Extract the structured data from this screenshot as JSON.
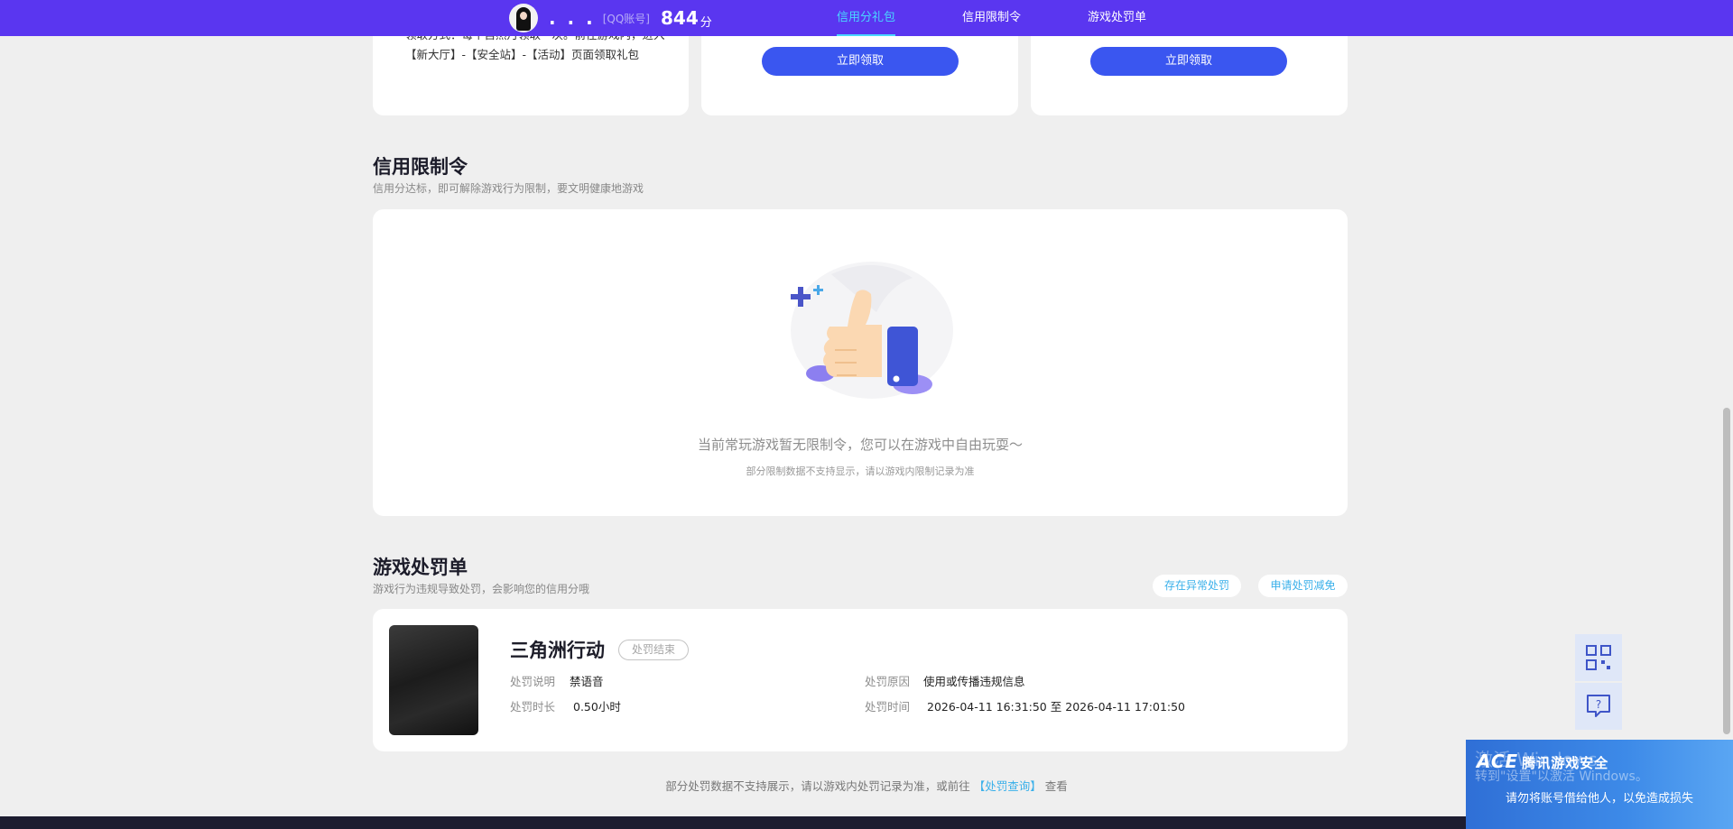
{
  "header": {
    "nickname": ". . .",
    "account_label": "[QQ账号]",
    "score": "844",
    "score_unit": "分",
    "nav": [
      {
        "label": "信用分礼包",
        "active": true
      },
      {
        "label": "信用限制令",
        "active": false
      },
      {
        "label": "游戏处罚单",
        "active": false
      }
    ]
  },
  "gift_cards": {
    "method_text": "领取方式：每个自然月领取一次。前往游戏内，进入【新大厅】-【安全站】-【活动】页面领取礼包",
    "claim_label": "立即领取"
  },
  "restriction": {
    "title": "信用限制令",
    "subtitle": "信用分达标，即可解除游戏行为限制，要文明健康地游戏",
    "empty_title": "当前常玩游戏暂无限制令，您可以在游戏中自由玩耍～",
    "empty_sub": "部分限制数据不支持显示，请以游戏内限制记录为准"
  },
  "penalty": {
    "title": "游戏处罚单",
    "subtitle": "游戏行为违规导致处罚，会影响您的信用分哦",
    "abnormal_button": "存在异常处罚",
    "reduce_button": "申请处罚减免",
    "item": {
      "game": "三角洲行动",
      "status": "处罚结束",
      "desc_label": "处罚说明",
      "desc_value": "禁语音",
      "duration_label": "处罚时长",
      "duration_value": "0.50小时",
      "reason_label": "处罚原因",
      "reason_value": "使用或传播违规信息",
      "time_label": "处罚时间",
      "time_start": "2026-04-11 16:31:50",
      "time_sep": "至",
      "time_end": "2026-04-11 17:01:50"
    }
  },
  "footer": {
    "note_before": "部分处罚数据不支持展示，请以游戏内处罚记录为准，或前往",
    "link": "【处罚查询】",
    "note_after": "查看"
  },
  "toast": {
    "brand_ace": "ACE",
    "brand": "腾讯游戏安全",
    "watermark_1": "激活 Windows",
    "watermark_2": "转到\"设置\"以激活 Windows。",
    "warning": "请勿将账号借给他人，以免造成损失"
  },
  "colors": {
    "topbar": "#5a36f0",
    "accent": "#3a56f0",
    "active_nav": "#49d7ff",
    "link": "#3ab0ea"
  },
  "icons": {
    "side_top": "qr-code-icon",
    "side_bottom": "help-chat-icon",
    "empty_illustration": "thumbs-up-icon"
  }
}
